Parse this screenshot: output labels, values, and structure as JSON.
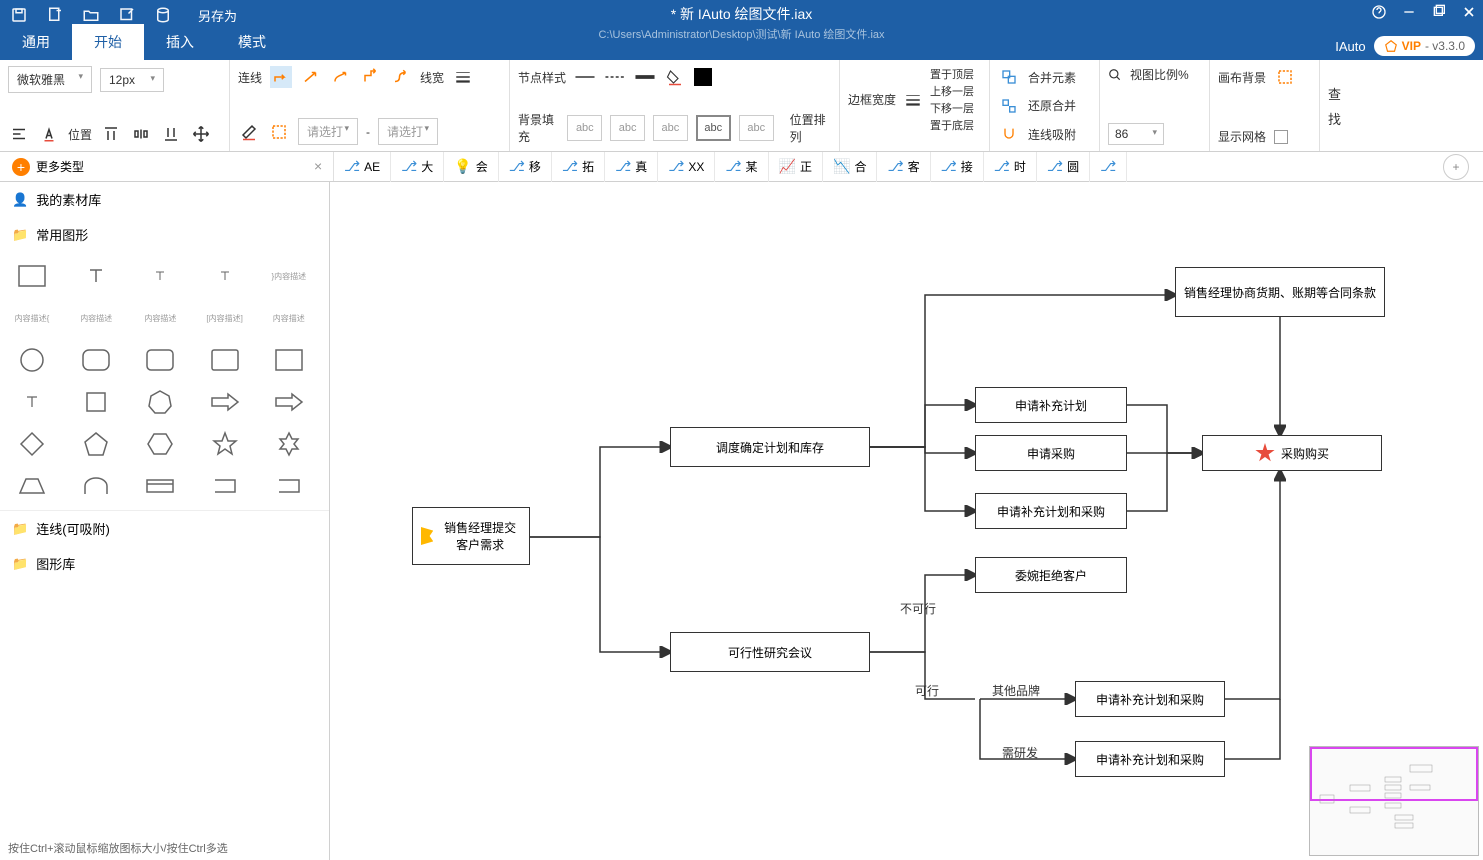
{
  "titlebar": {
    "saveas": "另存为",
    "doc_title": "* 新 IAuto 绘图文件.iax",
    "doc_path": "C:\\Users\\Administrator\\Desktop\\测试\\新 IAuto 绘图文件.iax",
    "brand": "IAuto",
    "vip": "VIP",
    "version": " - v3.3.0"
  },
  "menutabs": {
    "t0": "通用",
    "t1": "开始",
    "t2": "插入",
    "t3": "模式"
  },
  "ribbon": {
    "font_family": "微软雅黑",
    "font_size": "12px",
    "position_label": "位置",
    "line_label": "连线",
    "linewidth_label": "线宽",
    "nodestyle_label": "节点样式",
    "placeholder_select": "请选打",
    "bgfill_label": "背景填充",
    "abc": "abc",
    "posarr_label": "位置排列",
    "borderwidth_label": "边框宽度",
    "layer_top": "置于顶层",
    "layer_up": "上移一层",
    "layer_down": "下移一层",
    "layer_bottom": "置于底层",
    "merge_label": "合并元素",
    "restore_label": "还原合并",
    "snap_label": "连线吸附",
    "zoom_label": "视图比例%",
    "zoom_value": "86",
    "canvasbg_label": "画布背景",
    "showgrid_label": "显示网格",
    "find1": "查",
    "find2": "找"
  },
  "sectoolbar": {
    "more": "更多类型",
    "tags": {
      "t0": "AE",
      "t1": "大",
      "t2": "会",
      "t3": "移",
      "t4": "拓",
      "t5": "真",
      "t6": "XX",
      "t7": "某",
      "t8": "正",
      "t9": "合",
      "t10": "客",
      "t11": "接",
      "t12": "时",
      "t13": "圆"
    }
  },
  "sidebar": {
    "mylib": "我的素材库",
    "common": "常用图形",
    "lines": "连线(可吸附)",
    "shapelib": "图形库",
    "tiny_label": "内容描述"
  },
  "nodes": {
    "n1": "销售经理提交客户需求",
    "n2": "调度确定计划和库存",
    "n3": "可行性研究会议",
    "n4": "销售经理协商货期、账期等合同条款",
    "n5": "申请补充计划",
    "n6": "申请采购",
    "n7": "申请补充计划和采购",
    "n8": "采购购买",
    "n9": "委婉拒绝客户",
    "n10": "申请补充计划和采购",
    "n11": "申请补充计划和采购"
  },
  "edges": {
    "infeasible": "不可行",
    "feasible": "可行",
    "other_brand": "其他品牌",
    "need_rd": "需研发"
  },
  "footer": "按住Ctrl+滚动鼠标缩放图标大小/按住Ctrl多选"
}
